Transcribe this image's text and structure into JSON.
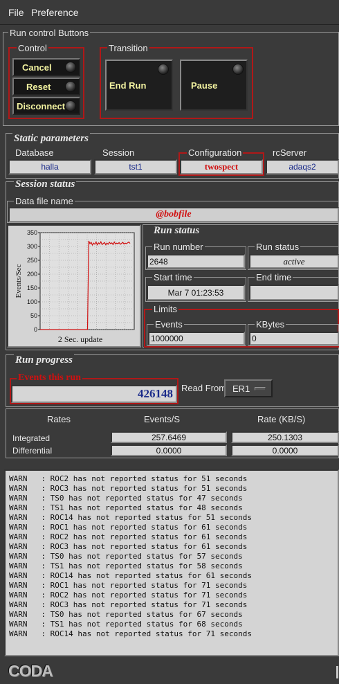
{
  "menu": {
    "file": "File",
    "preference": "Preference"
  },
  "run_control": {
    "title": "Run control Buttons",
    "control_title": "Control",
    "cancel": "Cancel",
    "reset": "Reset",
    "disconnect": "Disconnect",
    "transition_title": "Transition",
    "end_run": "End Run",
    "pause": "Pause"
  },
  "static_params": {
    "title": "Static parameters",
    "database_label": "Database",
    "database": "halla",
    "session_label": "Session",
    "session": "tst1",
    "configuration_label": "Configuration",
    "configuration": "twospect",
    "rcserver_label": "rcServer",
    "rcserver": "adaqs2"
  },
  "session_status": {
    "title": "Session status",
    "datafile_label": "Data file name",
    "datafile": "@bobfile"
  },
  "chart_data": {
    "type": "line",
    "title": "",
    "xlabel": "2 Sec. update",
    "ylabel": "Events/Sec",
    "ylim": [
      0,
      350
    ],
    "yticks": [
      "350",
      "300",
      "250",
      "200",
      "150",
      "100",
      "50",
      "0"
    ],
    "grid": true,
    "series": [
      {
        "values": [
          0,
          0,
          0,
          0,
          0,
          0,
          0,
          0,
          0,
          0,
          0,
          0,
          0,
          0,
          0,
          0,
          0,
          0,
          0,
          0,
          0,
          0,
          0,
          0,
          0,
          0,
          0,
          0,
          0,
          0,
          0,
          0,
          0,
          0,
          0,
          0,
          0,
          0,
          0,
          0,
          320,
          310,
          315,
          305,
          312,
          308,
          316,
          306,
          313,
          309,
          317,
          307,
          311,
          314,
          306,
          312,
          308,
          315,
          310,
          313,
          307,
          316,
          309,
          312,
          310,
          314,
          308,
          311,
          315,
          309,
          312,
          310,
          313,
          316,
          311
        ]
      }
    ]
  },
  "run_status": {
    "title": "Run status",
    "run_number_label": "Run number",
    "run_number": "2648",
    "status_label": "Run status",
    "status": "active",
    "start_label": "Start time",
    "start": "Mar 7 01:23:53",
    "end_label": "End time",
    "end": "",
    "limits_label": "Limits",
    "events_label": "Events",
    "events": "1000000",
    "kbytes_label": "KBytes",
    "kbytes": "0"
  },
  "run_progress": {
    "title": "Run progress",
    "events_label": "Events this run",
    "events": "426148",
    "read_from_label": "Read From:",
    "read_from": "ER1",
    "rates_header": "Rates",
    "events_s_header": "Events/S",
    "rate_kbs_header": "Rate (KB/S)",
    "integrated_label": "Integrated",
    "integrated_events": "257.6469",
    "integrated_rate": "250.1303",
    "differential_label": "Differential",
    "differential_events": "0.0000",
    "differential_rate": "0.0000"
  },
  "log": [
    "WARN   : ROC2 has not reported status for 51 seconds",
    "WARN   : ROC3 has not reported status for 51 seconds",
    "WARN   : TS0 has not reported status for 47 seconds",
    "WARN   : TS1 has not reported status for 48 seconds",
    "WARN   : ROC14 has not reported status for 51 seconds",
    "WARN   : ROC1 has not reported status for 61 seconds",
    "WARN   : ROC2 has not reported status for 61 seconds",
    "WARN   : ROC3 has not reported status for 61 seconds",
    "WARN   : TS0 has not reported status for 57 seconds",
    "WARN   : TS1 has not reported status for 58 seconds",
    "WARN   : ROC14 has not reported status for 61 seconds",
    "WARN   : ROC1 has not reported status for 71 seconds",
    "WARN   : ROC2 has not reported status for 71 seconds",
    "WARN   : ROC3 has not reported status for 71 seconds",
    "WARN   : TS0 has not reported status for 67 seconds",
    "WARN   : TS1 has not reported status for 68 seconds",
    "WARN   : ROC14 has not reported status for 71 seconds"
  ],
  "footer": {
    "logo": "CODA"
  }
}
